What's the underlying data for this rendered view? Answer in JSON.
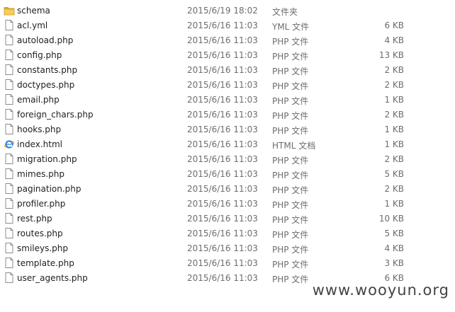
{
  "colors": {
    "text": "#1e1e1e",
    "meta_text": "#6d6d6d",
    "folder": "#e8b339",
    "ie": "#1e6fd0"
  },
  "files": [
    {
      "name": "schema",
      "date": "2015/6/19 18:02",
      "type": "文件夹",
      "size": "",
      "icon": "folder-icon"
    },
    {
      "name": "acl.yml",
      "date": "2015/6/16 11:03",
      "type": "YML 文件",
      "size": "6 KB",
      "icon": "document-icon"
    },
    {
      "name": "autoload.php",
      "date": "2015/6/16 11:03",
      "type": "PHP 文件",
      "size": "4 KB",
      "icon": "document-icon"
    },
    {
      "name": "config.php",
      "date": "2015/6/16 11:03",
      "type": "PHP 文件",
      "size": "13 KB",
      "icon": "document-icon"
    },
    {
      "name": "constants.php",
      "date": "2015/6/16 11:03",
      "type": "PHP 文件",
      "size": "2 KB",
      "icon": "document-icon"
    },
    {
      "name": "doctypes.php",
      "date": "2015/6/16 11:03",
      "type": "PHP 文件",
      "size": "2 KB",
      "icon": "document-icon"
    },
    {
      "name": "email.php",
      "date": "2015/6/16 11:03",
      "type": "PHP 文件",
      "size": "1 KB",
      "icon": "document-icon"
    },
    {
      "name": "foreign_chars.php",
      "date": "2015/6/16 11:03",
      "type": "PHP 文件",
      "size": "2 KB",
      "icon": "document-icon"
    },
    {
      "name": "hooks.php",
      "date": "2015/6/16 11:03",
      "type": "PHP 文件",
      "size": "1 KB",
      "icon": "document-icon"
    },
    {
      "name": "index.html",
      "date": "2015/6/16 11:03",
      "type": "HTML 文档",
      "size": "1 KB",
      "icon": "ie-icon"
    },
    {
      "name": "migration.php",
      "date": "2015/6/16 11:03",
      "type": "PHP 文件",
      "size": "2 KB",
      "icon": "document-icon"
    },
    {
      "name": "mimes.php",
      "date": "2015/6/16 11:03",
      "type": "PHP 文件",
      "size": "5 KB",
      "icon": "document-icon"
    },
    {
      "name": "pagination.php",
      "date": "2015/6/16 11:03",
      "type": "PHP 文件",
      "size": "2 KB",
      "icon": "document-icon"
    },
    {
      "name": "profiler.php",
      "date": "2015/6/16 11:03",
      "type": "PHP 文件",
      "size": "1 KB",
      "icon": "document-icon"
    },
    {
      "name": "rest.php",
      "date": "2015/6/16 11:03",
      "type": "PHP 文件",
      "size": "10 KB",
      "icon": "document-icon"
    },
    {
      "name": "routes.php",
      "date": "2015/6/16 11:03",
      "type": "PHP 文件",
      "size": "5 KB",
      "icon": "document-icon"
    },
    {
      "name": "smileys.php",
      "date": "2015/6/16 11:03",
      "type": "PHP 文件",
      "size": "4 KB",
      "icon": "document-icon"
    },
    {
      "name": "template.php",
      "date": "2015/6/16 11:03",
      "type": "PHP 文件",
      "size": "3 KB",
      "icon": "document-icon"
    },
    {
      "name": "user_agents.php",
      "date": "2015/6/16 11:03",
      "type": "PHP 文件",
      "size": "6 KB",
      "icon": "document-icon"
    }
  ],
  "watermark": "www.wooyun.org"
}
